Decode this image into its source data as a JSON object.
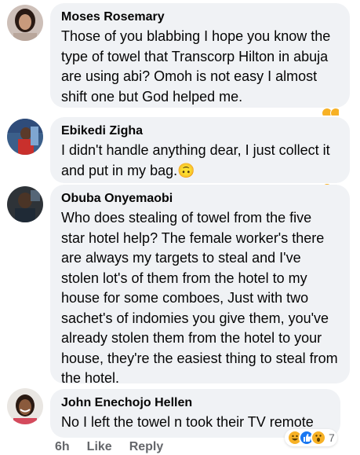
{
  "comments": [
    {
      "author": "Moses Rosemary",
      "text": "Those of you blabbing I hope you know the type of towel that Transcorp Hilton in abuja are using abi? Omoh is not easy I almost shift one but God helped me."
    },
    {
      "author": "Ebikedi Zigha",
      "text": "I didn't handle anything dear, I just collect it and put in my bag.",
      "emoji": "🙃"
    },
    {
      "author": "Obuba Onyemaobi",
      "text": "Who does stealing of towel from the five star hotel help? The female worker's there are always my targets to steal and I've stolen lot's of them from the hotel to my house for some comboes, Just with two sachet's of indomies you give them, you've already stolen them from the hotel to your house, they're the easiest thing to steal from the hotel."
    },
    {
      "author": "John Enechojo Hellen",
      "text": "No I left the towel n took their TV remote",
      "reaction_count": "7",
      "time": "6h",
      "like_label": "Like",
      "reply_label": "Reply"
    }
  ],
  "colors": {
    "bubble": "#f0f2f5",
    "meta": "#65676b",
    "haha": "#f7b125",
    "like": "#1877f2"
  },
  "icons": [
    "upside-down-face-emoji",
    "haha-reaction-icon",
    "like-reaction-icon",
    "wow-reaction-icon"
  ]
}
